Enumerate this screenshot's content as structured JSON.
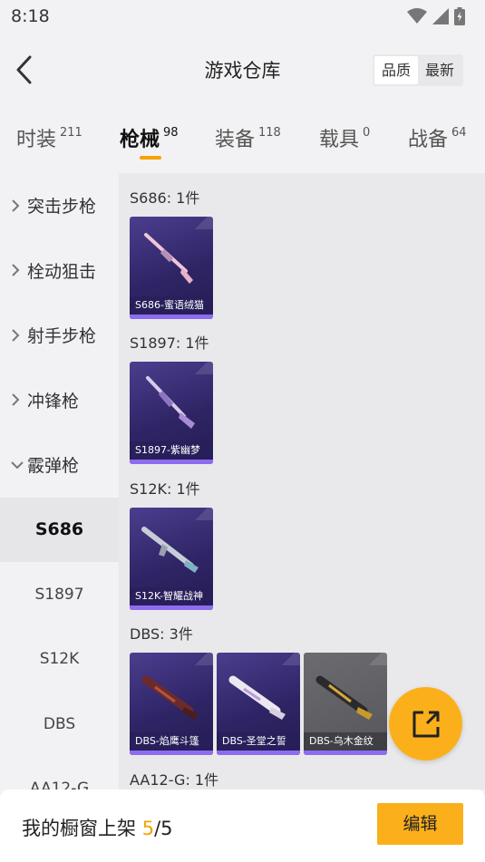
{
  "status_bar": {
    "time": "8:18"
  },
  "header": {
    "title": "游戏仓库",
    "sort_options": [
      "品质",
      "最新"
    ]
  },
  "tabs": [
    {
      "label": "时装",
      "count": "211"
    },
    {
      "label": "枪械",
      "count": "98"
    },
    {
      "label": "装备",
      "count": "118"
    },
    {
      "label": "载具",
      "count": "0"
    },
    {
      "label": "战备",
      "count": "64"
    }
  ],
  "sidebar": {
    "categories": [
      "突击步枪",
      "栓动狙击",
      "射手步枪",
      "冲锋枪",
      "霰弹枪"
    ],
    "sub_items": [
      "S686",
      "S1897",
      "S12K",
      "DBS",
      "AA12-G"
    ]
  },
  "groups": [
    {
      "title": "S686: 1件",
      "items": [
        {
          "name": "S686-蜜语绒猫",
          "rarity": "purple"
        }
      ]
    },
    {
      "title": "S1897: 1件",
      "items": [
        {
          "name": "S1897-紫幽梦",
          "rarity": "purple"
        }
      ]
    },
    {
      "title": "S12K: 1件",
      "items": [
        {
          "name": "S12K-智耀战神",
          "rarity": "purple"
        }
      ]
    },
    {
      "title": "DBS: 3件",
      "items": [
        {
          "name": "DBS-焰鹰斗篷",
          "rarity": "purple"
        },
        {
          "name": "DBS-圣堂之誓",
          "rarity": "purple"
        },
        {
          "name": "DBS-乌木金纹",
          "rarity": "gray"
        }
      ]
    },
    {
      "title": "AA12-G: 1件",
      "items": []
    }
  ],
  "footer": {
    "label": "我的橱窗上架 ",
    "current": "5",
    "total": "/5",
    "edit_label": "编辑"
  },
  "colors": {
    "accent": "#fbb01b",
    "rarity_purple": "#2f2566",
    "rarity_gray": "#5f5f64"
  },
  "icons": [
    "wifi-icon",
    "signal-icon",
    "battery-icon",
    "back-arrow-icon",
    "chevron-right-icon",
    "chevron-down-icon",
    "share-icon"
  ]
}
